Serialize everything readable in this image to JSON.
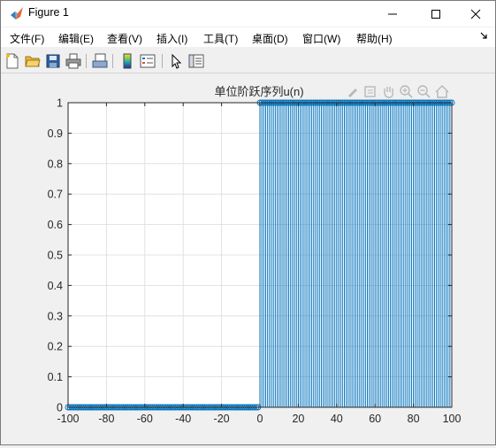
{
  "window": {
    "title": "Figure 1",
    "controls": {
      "minimize": "minimize",
      "maximize": "maximize",
      "close": "close"
    }
  },
  "menu": {
    "items": [
      {
        "label": "文件(F)"
      },
      {
        "label": "编辑(E)"
      },
      {
        "label": "查看(V)"
      },
      {
        "label": "插入(I)"
      },
      {
        "label": "工具(T)"
      },
      {
        "label": "桌面(D)"
      },
      {
        "label": "窗口(W)"
      },
      {
        "label": "帮助(H)"
      }
    ],
    "overflow_icon": "arrow-icon"
  },
  "toolbar": {
    "buttons": [
      "new-figure",
      "open-file",
      "save",
      "print",
      "print-preview",
      "insert-colorbar",
      "insert-legend",
      "edit-plot-cursor",
      "property-inspector"
    ]
  },
  "axes_toolbar": {
    "buttons": [
      "brush",
      "data-tips",
      "pan",
      "zoom-in",
      "zoom-out",
      "home"
    ]
  },
  "chart_data": {
    "type": "stem",
    "title": "单位阶跃序列u(n)",
    "n_range": [
      -100,
      100
    ],
    "step_at": 0,
    "values_before_step": 0,
    "values_from_step": 1,
    "xlim": [
      -100,
      100
    ],
    "ylim": [
      0,
      1
    ],
    "xticks": [
      "-100",
      "-80",
      "-60",
      "-40",
      "-20",
      "0",
      "20",
      "40",
      "60",
      "80",
      "100"
    ],
    "yticks": [
      "0",
      "0.1",
      "0.2",
      "0.3",
      "0.4",
      "0.5",
      "0.6",
      "0.7",
      "0.8",
      "0.9",
      "1"
    ],
    "grid": true,
    "color": "#0072bd"
  }
}
